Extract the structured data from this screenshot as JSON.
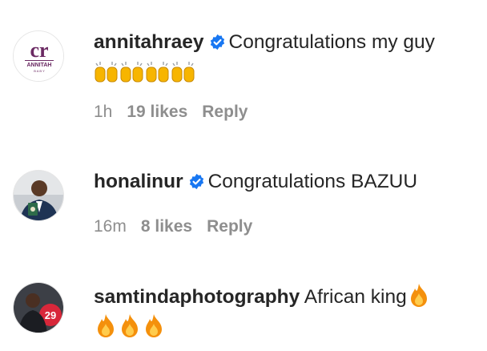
{
  "comments": [
    {
      "username": "annitahraey",
      "verified": true,
      "text": "Congratulations my guy",
      "emoji": [
        "raising-hands",
        "raising-hands",
        "raising-hands",
        "raising-hands"
      ],
      "time": "1h",
      "likes": "19 likes",
      "reply": "Reply",
      "avatar": {
        "logo_text": "ANNITAH",
        "sub_text": "B A B Y"
      }
    },
    {
      "username": "honalinur",
      "verified": true,
      "text": "Congratulations BAZUU",
      "time": "16m",
      "likes": "8 likes",
      "reply": "Reply",
      "avatar": {
        "icon": "person-photo-icon"
      }
    },
    {
      "username": "samtindaphotography",
      "verified": false,
      "text": "African king",
      "emoji": [
        "fire",
        "fire",
        "fire",
        "fire"
      ],
      "avatar": {
        "icon": "person-photo-icon",
        "badge_text": "29"
      }
    }
  ],
  "colors": {
    "verified": "#1877f2",
    "meta": "#8e8e8e",
    "text": "#262626",
    "logo": "#6b2a63"
  }
}
